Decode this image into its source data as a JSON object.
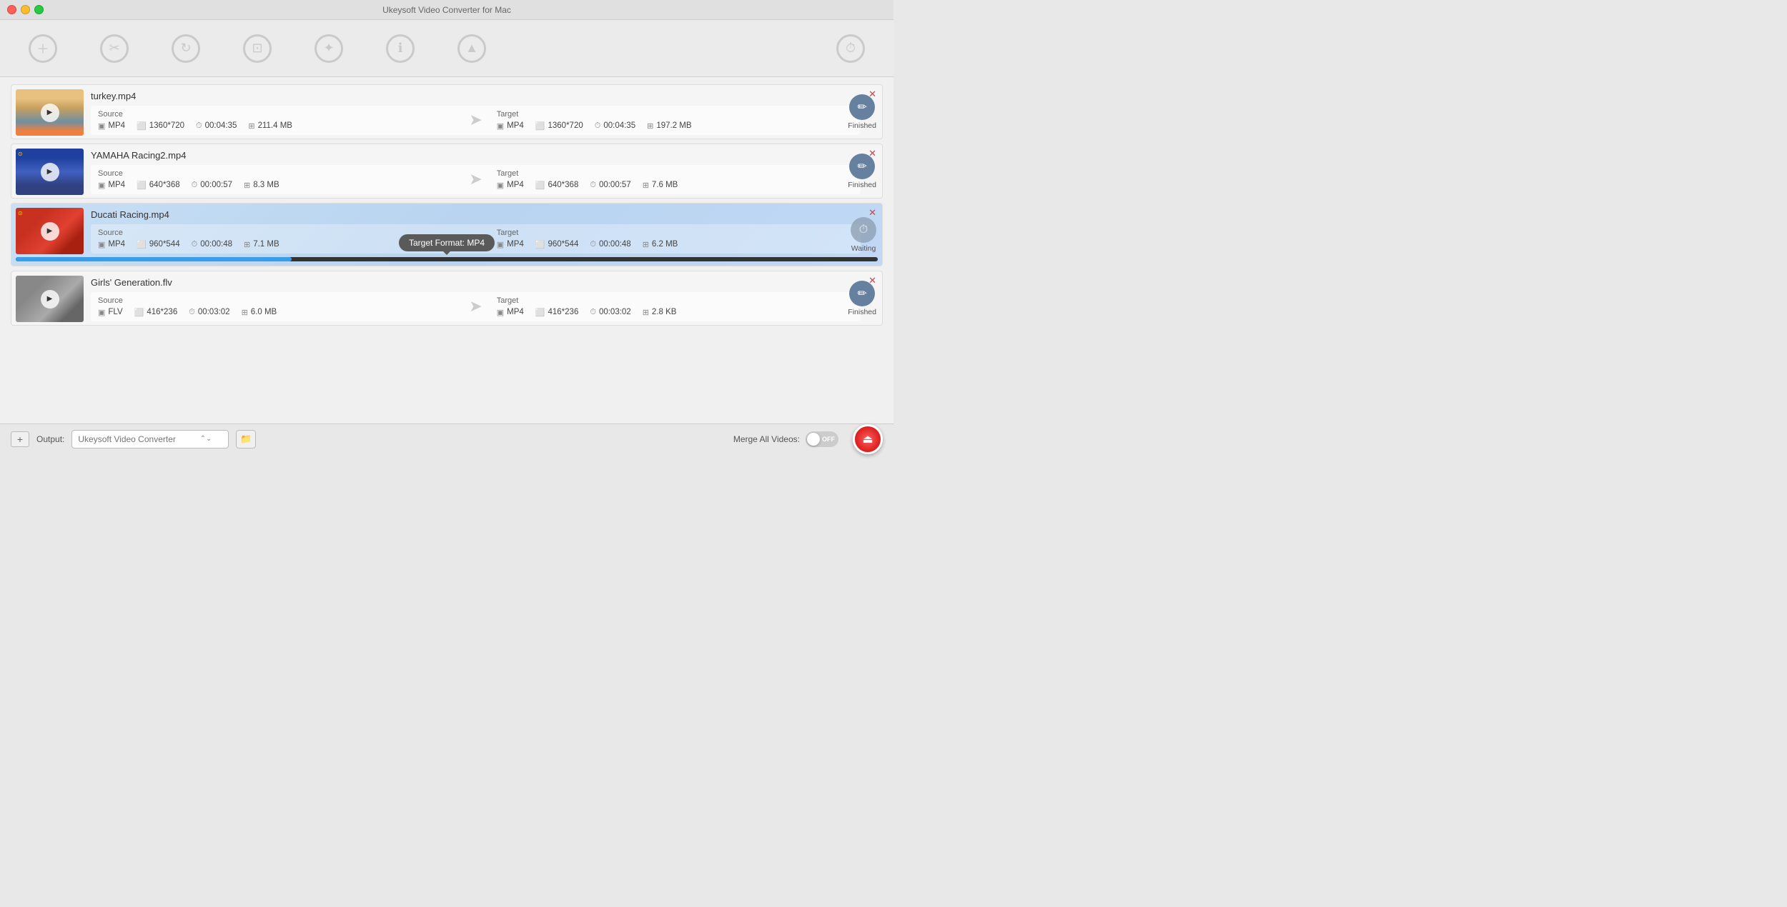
{
  "app": {
    "title": "Ukeysoft Video Converter for Mac"
  },
  "titlebar": {
    "close_btn": "×",
    "minimize_btn": "–",
    "maximize_btn": "+"
  },
  "toolbar": {
    "items": [
      {
        "id": "add",
        "icon": "+",
        "shape": "circle-plus"
      },
      {
        "id": "cut",
        "icon": "✂",
        "shape": "circle-scissors"
      },
      {
        "id": "refresh",
        "icon": "↻",
        "shape": "circle-refresh"
      },
      {
        "id": "compress",
        "icon": "⊡",
        "shape": "circle-compress"
      },
      {
        "id": "sparkle",
        "icon": "✦",
        "shape": "circle-sparkle"
      },
      {
        "id": "info",
        "icon": "ℹ",
        "shape": "circle-info"
      },
      {
        "id": "share",
        "icon": "▲",
        "shape": "circle-share"
      },
      {
        "id": "history",
        "icon": "🕐",
        "shape": "circle-history"
      }
    ]
  },
  "videos": [
    {
      "id": "turkey",
      "filename": "turkey.mp4",
      "thumbnail_style": "turkey",
      "source": {
        "label": "Source",
        "format": "MP4",
        "resolution": "1360*720",
        "duration": "00:04:35",
        "size": "211.4 MB"
      },
      "target": {
        "label": "Target",
        "format": "MP4",
        "resolution": "1360*720",
        "duration": "00:04:35",
        "size": "197.2 MB"
      },
      "status": "Finished",
      "status_type": "finished",
      "active": false
    },
    {
      "id": "yamaha",
      "filename": "YAMAHA Racing2.mp4",
      "thumbnail_style": "yamaha",
      "source": {
        "label": "Source",
        "format": "MP4",
        "resolution": "640*368",
        "duration": "00:00:57",
        "size": "8.3 MB"
      },
      "target": {
        "label": "Target",
        "format": "MP4",
        "resolution": "640*368",
        "duration": "00:00:57",
        "size": "7.6 MB"
      },
      "status": "Finished",
      "status_type": "finished",
      "active": false
    },
    {
      "id": "ducati",
      "filename": "Ducati Racing.mp4",
      "thumbnail_style": "ducati",
      "source": {
        "label": "Source",
        "format": "MP4",
        "resolution": "960*544",
        "duration": "00:00:48",
        "size": "7.1 MB"
      },
      "target": {
        "label": "Target",
        "format": "MP4",
        "resolution": "960*544",
        "duration": "00:00:48",
        "size": "6.2 MB"
      },
      "status": "Waiting",
      "status_type": "waiting",
      "active": true,
      "progress": 32
    },
    {
      "id": "girls",
      "filename": "Girls' Generation.flv",
      "thumbnail_style": "girls",
      "source": {
        "label": "Source",
        "format": "FLV",
        "resolution": "416*236",
        "duration": "00:03:02",
        "size": "6.0 MB"
      },
      "target": {
        "label": "Target",
        "format": "MP4",
        "resolution": "416*236",
        "duration": "00:03:02",
        "size": "2.8 KB"
      },
      "status": "Finished",
      "status_type": "finished",
      "active": false
    }
  ],
  "tooltip": {
    "text": "Target Format: MP4"
  },
  "footer": {
    "add_label": "+",
    "output_label": "Output:",
    "output_placeholder": "Ukeysoft Video Converter",
    "merge_label": "Merge All Videos:",
    "toggle_state": "OFF"
  }
}
